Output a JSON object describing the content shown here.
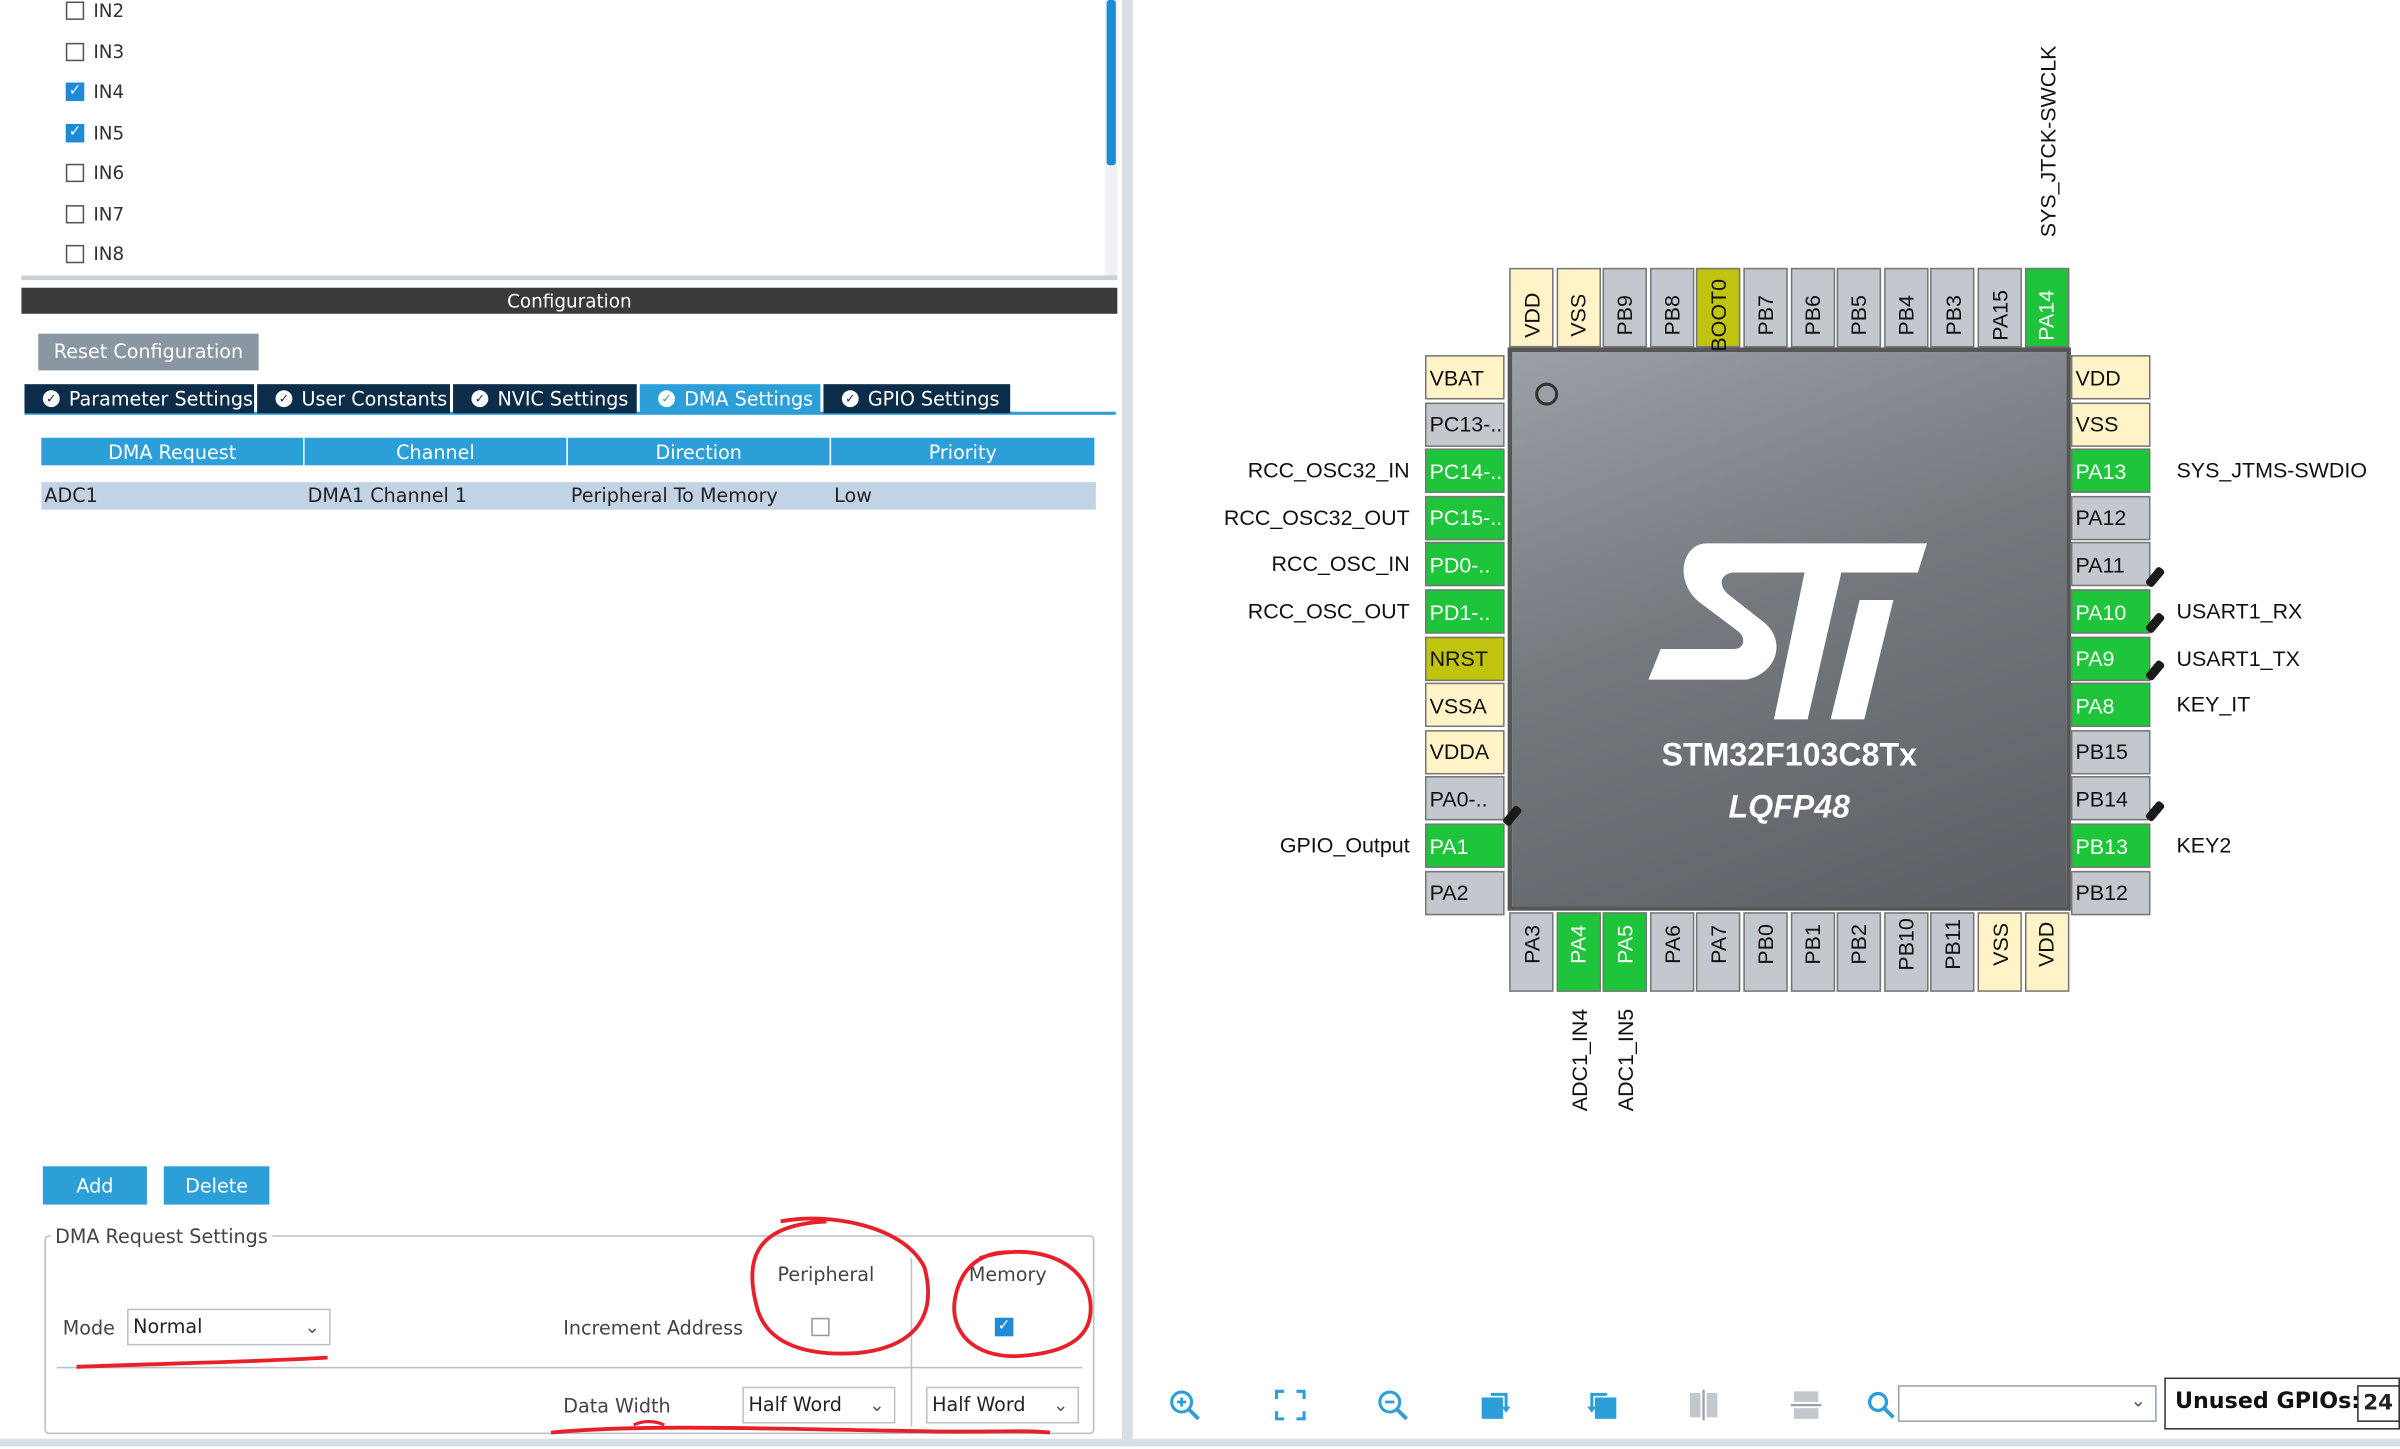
{
  "in_list": {
    "items": [
      {
        "label": "IN2",
        "checked": false
      },
      {
        "label": "IN3",
        "checked": false
      },
      {
        "label": "IN4",
        "checked": true
      },
      {
        "label": "IN5",
        "checked": true
      },
      {
        "label": "IN6",
        "checked": false
      },
      {
        "label": "IN7",
        "checked": false
      },
      {
        "label": "IN8",
        "checked": false
      }
    ]
  },
  "configuration": {
    "header": "Configuration",
    "reset_label": "Reset Configuration",
    "tabs": [
      {
        "label": "Parameter Settings",
        "active": false
      },
      {
        "label": "User Constants",
        "active": false
      },
      {
        "label": "NVIC Settings",
        "active": false
      },
      {
        "label": "DMA Settings",
        "active": true
      },
      {
        "label": "GPIO Settings",
        "active": false
      }
    ]
  },
  "dma_table": {
    "headers": [
      "DMA Request",
      "Channel",
      "Direction",
      "Priority"
    ],
    "rows": [
      [
        "ADC1",
        "DMA1 Channel 1",
        "Peripheral To Memory",
        "Low"
      ]
    ]
  },
  "buttons": {
    "add": "Add",
    "delete": "Delete"
  },
  "request_settings": {
    "legend": "DMA Request Settings",
    "mode_label": "Mode",
    "mode_value": "Normal",
    "increment_label": "Increment Address",
    "peripheral_header": "Peripheral",
    "memory_header": "Memory",
    "peripheral_increment": false,
    "memory_increment": true,
    "data_width_label": "Data Width",
    "peripheral_width": "Half Word",
    "memory_width": "Half Word"
  },
  "chip": {
    "name": "STM32F103C8Tx",
    "package": "LQFP48",
    "top_pins": [
      {
        "label": "VDD",
        "color": "yellow"
      },
      {
        "label": "VSS",
        "color": "yellow"
      },
      {
        "label": "PB9",
        "color": "gray"
      },
      {
        "label": "PB8",
        "color": "gray"
      },
      {
        "label": "BOOT0",
        "color": "olive"
      },
      {
        "label": "PB7",
        "color": "gray"
      },
      {
        "label": "PB6",
        "color": "gray"
      },
      {
        "label": "PB5",
        "color": "gray"
      },
      {
        "label": "PB4",
        "color": "gray"
      },
      {
        "label": "PB3",
        "color": "gray"
      },
      {
        "label": "PA15",
        "color": "gray"
      },
      {
        "label": "PA14",
        "color": "green"
      }
    ],
    "left_pins": [
      {
        "label": "VBAT",
        "color": "yellow"
      },
      {
        "label": "PC13-..",
        "color": "gray"
      },
      {
        "label": "PC14-..",
        "color": "green"
      },
      {
        "label": "PC15-..",
        "color": "green"
      },
      {
        "label": "PD0-..",
        "color": "green"
      },
      {
        "label": "PD1-..",
        "color": "green"
      },
      {
        "label": "NRST",
        "color": "olive"
      },
      {
        "label": "VSSA",
        "color": "yellow"
      },
      {
        "label": "VDDA",
        "color": "yellow"
      },
      {
        "label": "PA0-..",
        "color": "gray"
      },
      {
        "label": "PA1",
        "color": "green"
      },
      {
        "label": "PA2",
        "color": "gray"
      }
    ],
    "right_pins": [
      {
        "label": "VDD",
        "color": "yellow"
      },
      {
        "label": "VSS",
        "color": "yellow"
      },
      {
        "label": "PA13",
        "color": "green"
      },
      {
        "label": "PA12",
        "color": "gray"
      },
      {
        "label": "PA11",
        "color": "gray"
      },
      {
        "label": "PA10",
        "color": "green"
      },
      {
        "label": "PA9",
        "color": "green"
      },
      {
        "label": "PA8",
        "color": "green"
      },
      {
        "label": "PB15",
        "color": "gray"
      },
      {
        "label": "PB14",
        "color": "gray"
      },
      {
        "label": "PB13",
        "color": "green"
      },
      {
        "label": "PB12",
        "color": "gray"
      }
    ],
    "bottom_pins": [
      {
        "label": "PA3",
        "color": "gray"
      },
      {
        "label": "PA4",
        "color": "green"
      },
      {
        "label": "PA5",
        "color": "green"
      },
      {
        "label": "PA6",
        "color": "gray"
      },
      {
        "label": "PA7",
        "color": "gray"
      },
      {
        "label": "PB0",
        "color": "gray"
      },
      {
        "label": "PB1",
        "color": "gray"
      },
      {
        "label": "PB2",
        "color": "gray"
      },
      {
        "label": "PB10",
        "color": "gray"
      },
      {
        "label": "PB11",
        "color": "gray"
      },
      {
        "label": "VSS",
        "color": "yellow"
      },
      {
        "label": "VDD",
        "color": "yellow"
      }
    ],
    "left_signals": [
      {
        "pin": "PC14-..",
        "label": "RCC_OSC32_IN"
      },
      {
        "pin": "PC15-..",
        "label": "RCC_OSC32_OUT"
      },
      {
        "pin": "PD0-..",
        "label": "RCC_OSC_IN"
      },
      {
        "pin": "PD1-..",
        "label": "RCC_OSC_OUT"
      },
      {
        "pin": "PA1",
        "label": "GPIO_Output"
      }
    ],
    "right_signals": [
      {
        "pin": "PA13",
        "label": "SYS_JTMS-SWDIO"
      },
      {
        "pin": "PA10",
        "label": "USART1_RX"
      },
      {
        "pin": "PA9",
        "label": "USART1_TX"
      },
      {
        "pin": "PA8",
        "label": "KEY_IT"
      },
      {
        "pin": "PB13",
        "label": "KEY2"
      }
    ],
    "top_signals": [
      {
        "pin": "PA14",
        "label": "SYS_JTCK-SWCLK"
      }
    ],
    "bottom_signals": [
      {
        "pin": "PA4",
        "label": "ADC1_IN4"
      },
      {
        "pin": "PA5",
        "label": "ADC1_IN5"
      }
    ]
  },
  "toolbar": {
    "icons": [
      "zoom-in-icon",
      "fit-screen-icon",
      "zoom-out-icon",
      "rotate-right-icon",
      "rotate-left-icon",
      "flip-vertical-icon",
      "flip-horizontal-icon",
      "search-icon"
    ],
    "unused_label": "Unused GPIOs:",
    "unused_value": "24 /"
  },
  "colors": {
    "accent": "#2c9fd9",
    "tab_dark": "#0c2d4a",
    "pin_green": "#1ec43a",
    "pin_gray": "#c2c8ce",
    "pin_yellow": "#fff3c7",
    "pin_olive": "#c1c40e",
    "annotation_red": "#e8202a"
  }
}
